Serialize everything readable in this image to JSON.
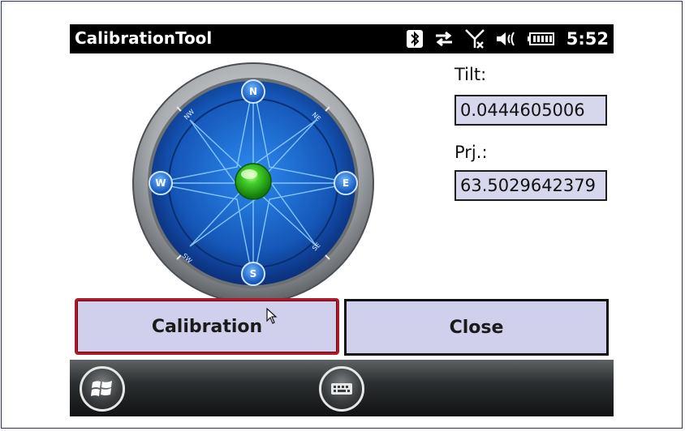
{
  "app": {
    "title": "CalibrationTool",
    "clock": "5:52"
  },
  "status_icons": [
    "bluetooth-icon",
    "data-transfer-icon",
    "no-signal-icon",
    "volume-icon",
    "battery-icon"
  ],
  "compass": {
    "north": "N",
    "south": "S",
    "east": "E",
    "west": "W",
    "ne": "NE",
    "nw": "NW",
    "se": "SE",
    "sw": "SW"
  },
  "readings": {
    "tilt_label": "Tilt:",
    "tilt_value": "0.0444605006",
    "prj_label": "Prj.:",
    "prj_value": "63.5029642379"
  },
  "buttons": {
    "calibration": "Calibration",
    "close": "Close"
  },
  "taskbar": {
    "start_icon": "windows-logo-icon",
    "keyboard_icon": "keyboard-icon"
  },
  "colors": {
    "button_fill": "#d0d0ec",
    "focus_border": "#b0182a",
    "compass_blue": "#1d6fd1",
    "bubble_green": "#2fc41a"
  }
}
